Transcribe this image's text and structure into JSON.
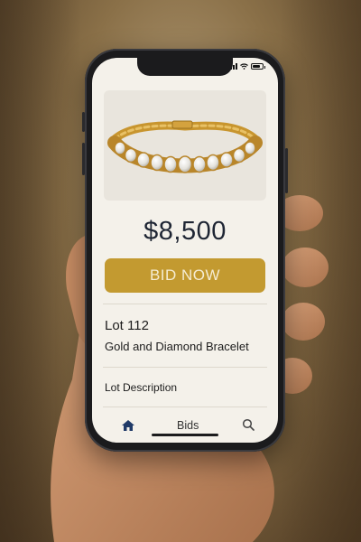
{
  "status_bar": {
    "signal_icon": "cellular-signal-icon",
    "wifi_icon": "wifi-icon",
    "battery_icon": "battery-icon"
  },
  "product": {
    "image_icon": "gold-diamond-bracelet-image"
  },
  "price": "$8,500",
  "bid_button_label": "BID NOW",
  "lot": {
    "number": "Lot 112",
    "title": "Gold and Diamond Bracelet",
    "description_label": "Lot Description"
  },
  "tab_bar": {
    "home_icon": "home-icon",
    "bids_label": "Bids",
    "search_icon": "search-icon"
  },
  "colors": {
    "accent": "#c39a30",
    "price_text": "#1e2533",
    "screen_bg": "#f4f1ea",
    "home_icon_active": "#1f3a68"
  }
}
